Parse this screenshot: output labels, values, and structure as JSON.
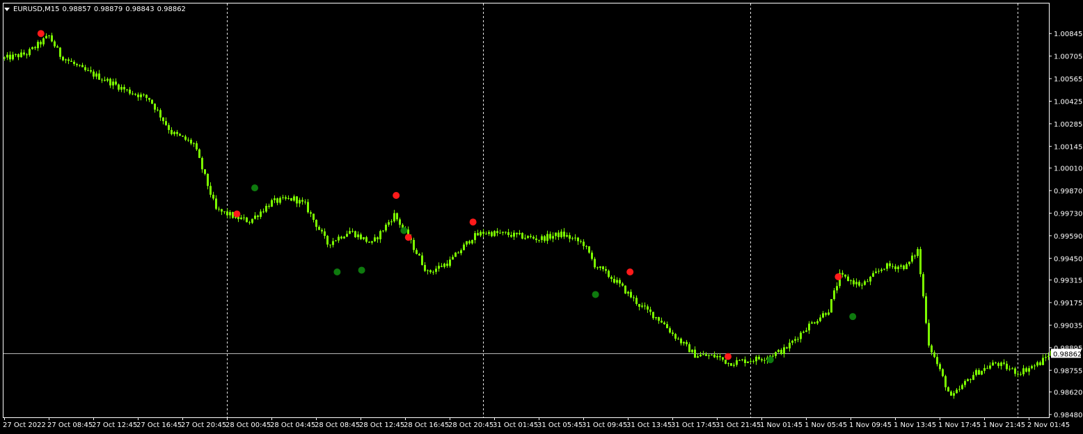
{
  "header": {
    "symbol": "EURUSD,M15",
    "open": "0.98857",
    "high": "0.98879",
    "low": "0.98843",
    "close": "0.98862"
  },
  "colors": {
    "background": "#000000",
    "candle": "#7CFC00",
    "sell_signal": "#ff1a1a",
    "buy_signal": "#0e7a0e",
    "grid_separator": "#ffffff",
    "axis": "#ffffff",
    "bid_line": "#b8b8b8"
  },
  "icons": {
    "menu": "triangle-down-icon"
  },
  "chart_data": {
    "type": "candlestick",
    "symbol": "EURUSD",
    "timeframe": "M15",
    "ylim": [
      0.9848,
      1.00915
    ],
    "y_ticks": [
      "1.00845",
      "1.00705",
      "1.00565",
      "1.00425",
      "1.00285",
      "1.00145",
      "1.00010",
      "0.99870",
      "0.99730",
      "0.99590",
      "0.99450",
      "0.99315",
      "0.99175",
      "0.99035",
      "0.98895",
      "0.98755",
      "0.98620",
      "0.98480"
    ],
    "current_price": "0.98862",
    "x_ticks": [
      "27 Oct 2022",
      "27 Oct 08:45",
      "27 Oct 12:45",
      "27 Oct 16:45",
      "27 Oct 20:45",
      "28 Oct 00:45",
      "28 Oct 04:45",
      "28 Oct 08:45",
      "28 Oct 12:45",
      "28 Oct 16:45",
      "28 Oct 20:45",
      "31 Oct 01:45",
      "31 Oct 05:45",
      "31 Oct 09:45",
      "31 Oct 13:45",
      "31 Oct 17:45",
      "31 Oct 21:45",
      "1 Nov 01:45",
      "1 Nov 05:45",
      "1 Nov 09:45",
      "1 Nov 13:45",
      "1 Nov 17:45",
      "1 Nov 21:45",
      "2 Nov 01:45"
    ],
    "day_separators": [
      20,
      43,
      67,
      91
    ],
    "price_path": [
      [
        0,
        1.0069
      ],
      [
        2,
        1.0072
      ],
      [
        4,
        1.0083
      ],
      [
        5,
        1.0071
      ],
      [
        7,
        1.0062
      ],
      [
        9,
        1.0056
      ],
      [
        11,
        1.0049
      ],
      [
        13,
        1.0044
      ],
      [
        15,
        1.0023
      ],
      [
        17,
        1.0016
      ],
      [
        19,
        0.9975
      ],
      [
        21,
        0.997
      ],
      [
        22,
        0.9968
      ],
      [
        24,
        0.998
      ],
      [
        26,
        0.9982
      ],
      [
        27,
        0.9978
      ],
      [
        29,
        0.9954
      ],
      [
        31,
        0.9962
      ],
      [
        33,
        0.9954
      ],
      [
        35,
        0.9972
      ],
      [
        36,
        0.9961
      ],
      [
        38,
        0.9936
      ],
      [
        40,
        0.9943
      ],
      [
        42,
        0.9958
      ],
      [
        43,
        0.9961
      ],
      [
        45,
        0.996
      ],
      [
        48,
        0.9957
      ],
      [
        50,
        0.996
      ],
      [
        52,
        0.9954
      ],
      [
        53,
        0.9941
      ],
      [
        55,
        0.993
      ],
      [
        57,
        0.9916
      ],
      [
        59,
        0.9906
      ],
      [
        60,
        0.9898
      ],
      [
        62,
        0.9885
      ],
      [
        64,
        0.9884
      ],
      [
        65,
        0.988
      ],
      [
        68,
        0.9883
      ],
      [
        70,
        0.9888
      ],
      [
        72,
        0.9902
      ],
      [
        74,
        0.9913
      ],
      [
        75,
        0.9934
      ],
      [
        77,
        0.9928
      ],
      [
        79,
        0.994
      ],
      [
        81,
        0.994
      ],
      [
        82,
        0.995
      ],
      [
        83,
        0.9892
      ],
      [
        85,
        0.9858
      ],
      [
        87,
        0.9873
      ],
      [
        89,
        0.988
      ],
      [
        91,
        0.9874
      ],
      [
        93,
        0.988
      ],
      [
        94,
        0.9887
      ]
    ],
    "signals": [
      {
        "type": "sell",
        "price": 1.00845
      },
      {
        "type": "sell",
        "price": 0.99725
      },
      {
        "type": "buy",
        "price": 0.99887
      },
      {
        "type": "buy",
        "price": 0.99622
      },
      {
        "type": "sell",
        "price": 0.9958
      },
      {
        "type": "buy",
        "price": 0.99365
      },
      {
        "type": "buy",
        "price": 0.99376
      },
      {
        "type": "sell",
        "price": 0.9984
      },
      {
        "type": "sell",
        "price": 0.99675
      },
      {
        "type": "buy",
        "price": 0.99225
      },
      {
        "type": "sell",
        "price": 0.99365
      },
      {
        "type": "sell",
        "price": 0.9884
      },
      {
        "type": "buy",
        "price": 0.9882
      },
      {
        "type": "sell",
        "price": 0.99335
      },
      {
        "type": "buy",
        "price": 0.99088
      }
    ]
  }
}
